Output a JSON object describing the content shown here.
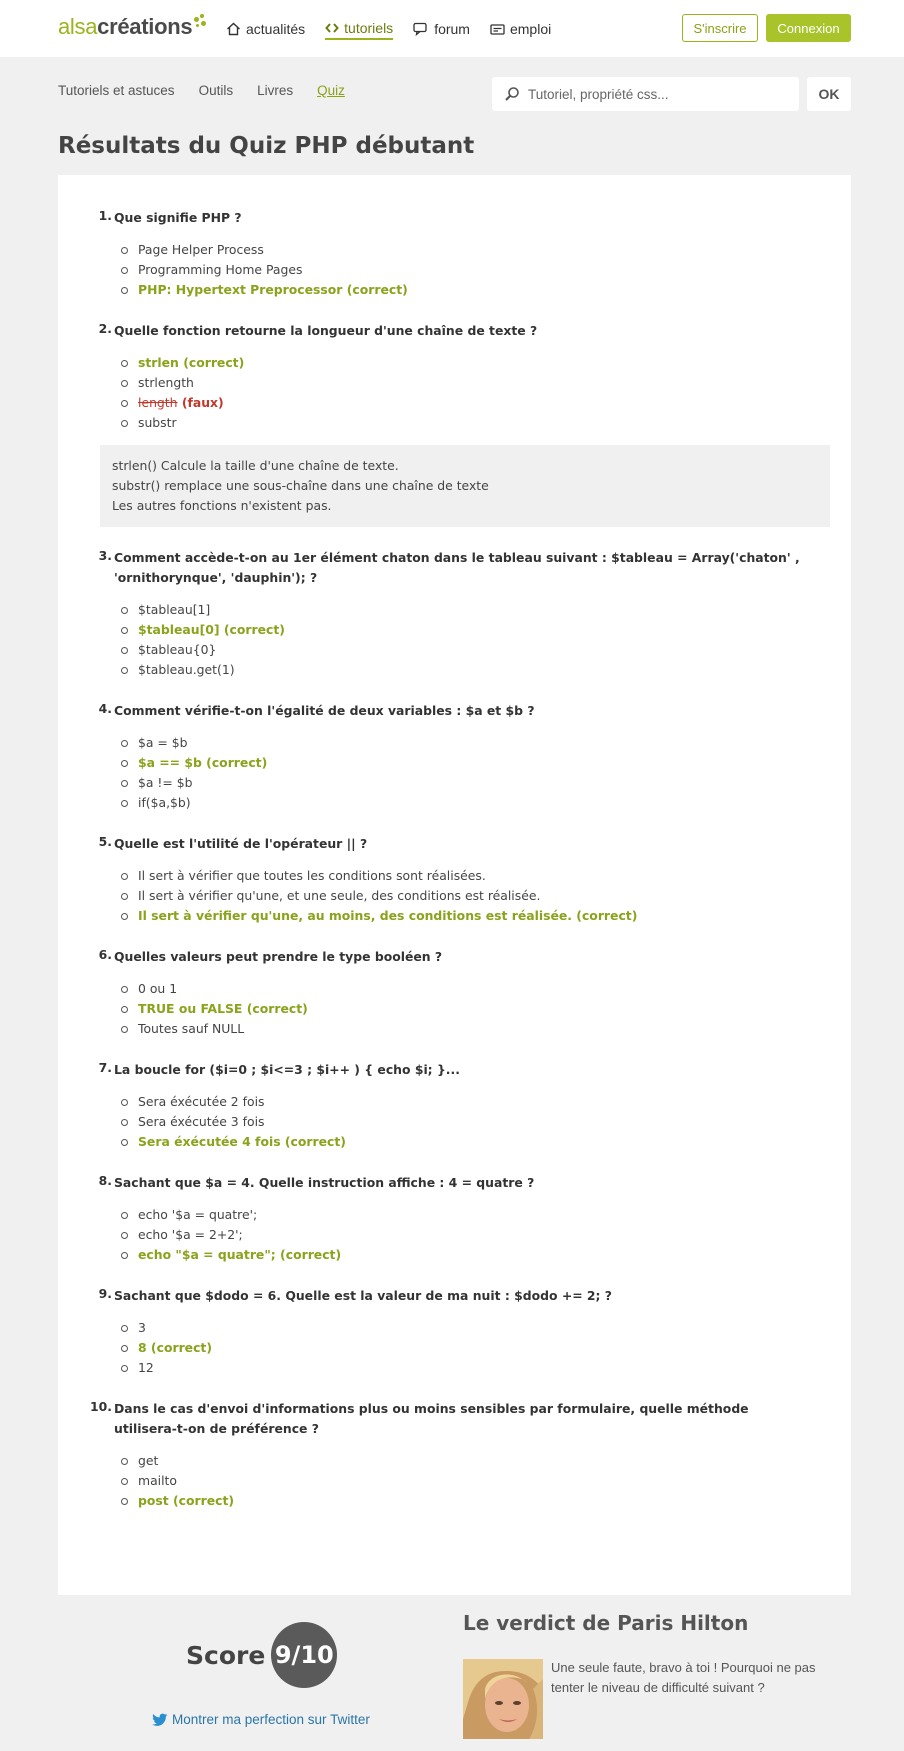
{
  "header": {
    "logo_part1": "alsa",
    "logo_part2": "créations",
    "nav": [
      {
        "label": "actualités",
        "icon": "home-icon"
      },
      {
        "label": "tutoriels",
        "icon": "code-icon",
        "active": true
      },
      {
        "label": "forum",
        "icon": "chat-icon"
      },
      {
        "label": "emploi",
        "icon": "briefcase-icon"
      }
    ],
    "signup_label": "S'inscrire",
    "login_label": "Connexion"
  },
  "subnav": [
    "Tutoriels et astuces",
    "Outils",
    "Livres",
    "Quiz"
  ],
  "search": {
    "placeholder": "Tutoriel, propriété css...",
    "button": "OK"
  },
  "page_title": "Résultats du Quiz PHP débutant",
  "questions": [
    {
      "num": "1.",
      "text": "Que signifie PHP ?",
      "answers": [
        {
          "text": "Page Helper Process",
          "state": "normal"
        },
        {
          "text": "Programming Home Pages",
          "state": "normal"
        },
        {
          "text": "PHP: Hypertext Preprocessor (correct)",
          "state": "correct"
        }
      ]
    },
    {
      "num": "2.",
      "text": "Quelle fonction retourne la longueur d'une chaîne de texte ?",
      "answers": [
        {
          "text": "strlen (correct)",
          "state": "correct"
        },
        {
          "text": "strlength",
          "state": "normal"
        },
        {
          "text": "length",
          "wrong_label": " (faux)",
          "state": "wrong"
        },
        {
          "text": "substr",
          "state": "normal"
        }
      ],
      "explanation": [
        "strlen() Calcule la taille d'une chaîne de texte.",
        "substr() remplace une sous-chaîne dans une chaîne de texte",
        "Les autres fonctions n'existent pas."
      ]
    },
    {
      "num": "3.",
      "text": "Comment accède-t-on au 1er élément chaton dans le tableau suivant : $tableau = Array('chaton' , 'ornithorynque', 'dauphin'); ?",
      "answers": [
        {
          "text": "$tableau[1]",
          "state": "normal"
        },
        {
          "text": "$tableau[0] (correct)",
          "state": "correct"
        },
        {
          "text": "$tableau{0}",
          "state": "normal"
        },
        {
          "text": "$tableau.get(1)",
          "state": "normal"
        }
      ]
    },
    {
      "num": "4.",
      "text": "Comment vérifie-t-on l'égalité de deux variables : $a et $b ?",
      "answers": [
        {
          "text": "$a = $b",
          "state": "normal"
        },
        {
          "text": "$a == $b (correct)",
          "state": "correct"
        },
        {
          "text": "$a != $b",
          "state": "normal"
        },
        {
          "text": "if($a,$b)",
          "state": "normal"
        }
      ]
    },
    {
      "num": "5.",
      "text": "Quelle est l'utilité de l'opérateur || ?",
      "answers": [
        {
          "text": "Il sert à vérifier que toutes les conditions sont réalisées.",
          "state": "normal"
        },
        {
          "text": "Il sert à vérifier qu'une, et une seule, des conditions est réalisée.",
          "state": "normal"
        },
        {
          "text": "Il sert à vérifier qu'une, au moins, des conditions est réalisée. (correct)",
          "state": "correct"
        }
      ]
    },
    {
      "num": "6.",
      "text": "Quelles valeurs peut prendre le type booléen ?",
      "answers": [
        {
          "text": "0 ou 1",
          "state": "normal"
        },
        {
          "text": "TRUE ou FALSE (correct)",
          "state": "correct"
        },
        {
          "text": "Toutes sauf NULL",
          "state": "normal"
        }
      ]
    },
    {
      "num": "7.",
      "text": "La boucle for ($i=0 ; $i<=3 ; $i++ ) { echo $i; }...",
      "answers": [
        {
          "text": "Sera éxécutée 2 fois",
          "state": "normal"
        },
        {
          "text": "Sera éxécutée 3 fois",
          "state": "normal"
        },
        {
          "text": "Sera éxécutée 4 fois (correct)",
          "state": "correct"
        }
      ]
    },
    {
      "num": "8.",
      "text": "Sachant que $a = 4. Quelle instruction affiche : 4 = quatre ?",
      "answers": [
        {
          "text": "echo '$a = quatre';",
          "state": "normal"
        },
        {
          "text": "echo '$a = 2+2';",
          "state": "normal"
        },
        {
          "text": "echo \"$a = quatre\"; (correct)",
          "state": "correct"
        }
      ]
    },
    {
      "num": "9.",
      "text": "Sachant que $dodo = 6. Quelle est la valeur de ma nuit : $dodo += 2; ?",
      "answers": [
        {
          "text": "3",
          "state": "normal"
        },
        {
          "text": "8 (correct)",
          "state": "correct"
        },
        {
          "text": "12",
          "state": "normal"
        }
      ]
    },
    {
      "num": "10.",
      "text": "Dans le cas d'envoi d'informations plus ou moins sensibles par formulaire, quelle méthode utilisera-t-on de préférence ?",
      "answers": [
        {
          "text": "get",
          "state": "normal"
        },
        {
          "text": "mailto",
          "state": "normal"
        },
        {
          "text": "post (correct)",
          "state": "correct"
        }
      ]
    }
  ],
  "score": {
    "label": "Score",
    "value": "9/10",
    "share_label": "Montrer ma perfection sur Twitter"
  },
  "verdict": {
    "title": "Le verdict de Paris Hilton",
    "text": "Une seule faute, bravo à toi ! Pourquoi ne pas tenter le niveau de difficulté suivant ?"
  },
  "colors": {
    "accent": "#9bb31c",
    "correct": "#89a31b",
    "wrong": "#c0392b",
    "link": "#2a76a8"
  }
}
